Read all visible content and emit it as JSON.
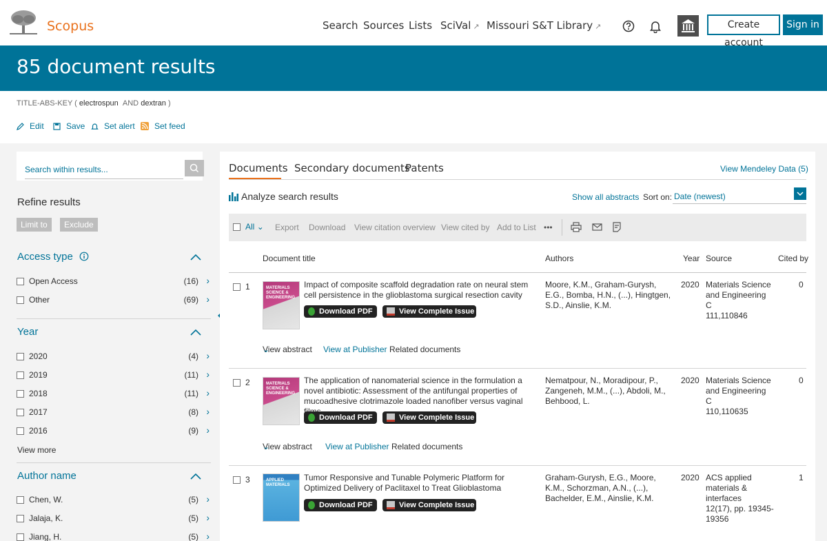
{
  "header": {
    "brand": "Scopus",
    "nav": [
      {
        "label": "Search",
        "external": false
      },
      {
        "label": "Sources",
        "external": false
      },
      {
        "label": "Lists",
        "external": false
      },
      {
        "label": "SciVal",
        "external": true
      },
      {
        "label": "Missouri S&T Library",
        "external": true
      }
    ],
    "external_arrow": "↗",
    "create_account": "Create account",
    "sign_in": "Sign in"
  },
  "banner": {
    "title": "85 document results"
  },
  "query": {
    "field": "TITLE-ABS-KEY",
    "open": "(",
    "term1": "electrospun",
    "op": "AND",
    "term2": "dextran",
    "close": ")"
  },
  "query_actions": [
    "Edit",
    "Save",
    "Set alert",
    "Set feed"
  ],
  "sidebar": {
    "search_placeholder": "Search within results...",
    "refine_title": "Refine results",
    "limit_to": "Limit to",
    "exclude": "Exclude",
    "access_type": {
      "title": "Access type",
      "items": [
        {
          "label": "Open Access",
          "count": "(16)"
        },
        {
          "label": "Other",
          "count": "(69)"
        }
      ]
    },
    "year": {
      "title": "Year",
      "items": [
        {
          "label": "2020",
          "count": "(4)"
        },
        {
          "label": "2019",
          "count": "(11)"
        },
        {
          "label": "2018",
          "count": "(11)"
        },
        {
          "label": "2017",
          "count": "(8)"
        },
        {
          "label": "2016",
          "count": "(9)"
        }
      ],
      "view_more": "View more"
    },
    "author": {
      "title": "Author name",
      "items": [
        {
          "label": "Chen, W.",
          "count": "(5)"
        },
        {
          "label": "Jalaja, K.",
          "count": "(5)"
        },
        {
          "label": "Jiang, H.",
          "count": "(5)"
        }
      ]
    }
  },
  "main": {
    "tabs": [
      "Documents",
      "Secondary documents",
      "Patents"
    ],
    "mendeley": "View Mendeley Data (5)",
    "analyze": "Analyze search results",
    "show_abstracts": "Show all abstracts",
    "sort_label": "Sort on:",
    "sort_value": "Date (newest)",
    "toolbar": {
      "all": "All",
      "items": [
        "Export",
        "Download",
        "View citation overview",
        "View cited by",
        "Add to List"
      ],
      "more": "•••"
    },
    "columns": {
      "title": "Document title",
      "authors": "Authors",
      "year": "Year",
      "source": "Source",
      "cited": "Cited by"
    },
    "download_pdf": "Download PDF",
    "view_issue": "View Complete Issue",
    "view_abstract": "View abstract",
    "view_publisher": "View at Publisher",
    "related": "Related documents",
    "results": [
      {
        "num": "1",
        "cover_text": "MATERIALS SCIENCE & ENGINEERING",
        "title": "Impact of composite scaffold degradation rate on neural stem cell persistence in the glioblastoma surgical resection cavity",
        "authors": "Moore, K.M., Graham-Gurysh, E.G., Bomba, H.N., (...), Hingtgen, S.D., Ainslie, K.M.",
        "year": "2020",
        "source_lines": [
          "Materials Science",
          "and Engineering",
          "C",
          "111,110846"
        ],
        "cited": "0"
      },
      {
        "num": "2",
        "cover_text": "MATERIALS SCIENCE & ENGINEERING",
        "title": "The application of nanomaterial science in the formulation a novel antibiotic: Assessment of the antifungal properties of mucoadhesive clotrimazole loaded nanofiber versus vaginal films",
        "authors": "Nematpour, N., Moradipour, P., Zangeneh, M.M., (...), Abdoli, M., Behbood, L.",
        "year": "2020",
        "source_lines": [
          "Materials Science",
          "and Engineering",
          "C",
          "110,110635"
        ],
        "cited": "0"
      },
      {
        "num": "3",
        "cover_text": "APPLIED MATERIALS",
        "title": "Tumor Responsive and Tunable Polymeric Platform for Optimized Delivery of Paclitaxel to Treat Glioblastoma",
        "authors": "Graham-Gurysh, E.G., Moore, K.M., Schorzman, A.N., (...), Bachelder, E.M., Ainslie, K.M.",
        "year": "2020",
        "source_lines": [
          "ACS applied",
          "materials &",
          "interfaces",
          "12(17), pp. 19345-",
          "19356"
        ],
        "cited": "1"
      }
    ]
  },
  "colors": {
    "primary": "#007398",
    "accent": "#e9711c",
    "header_bg": "#ffffff",
    "page_bg": "#f3f3f3"
  }
}
